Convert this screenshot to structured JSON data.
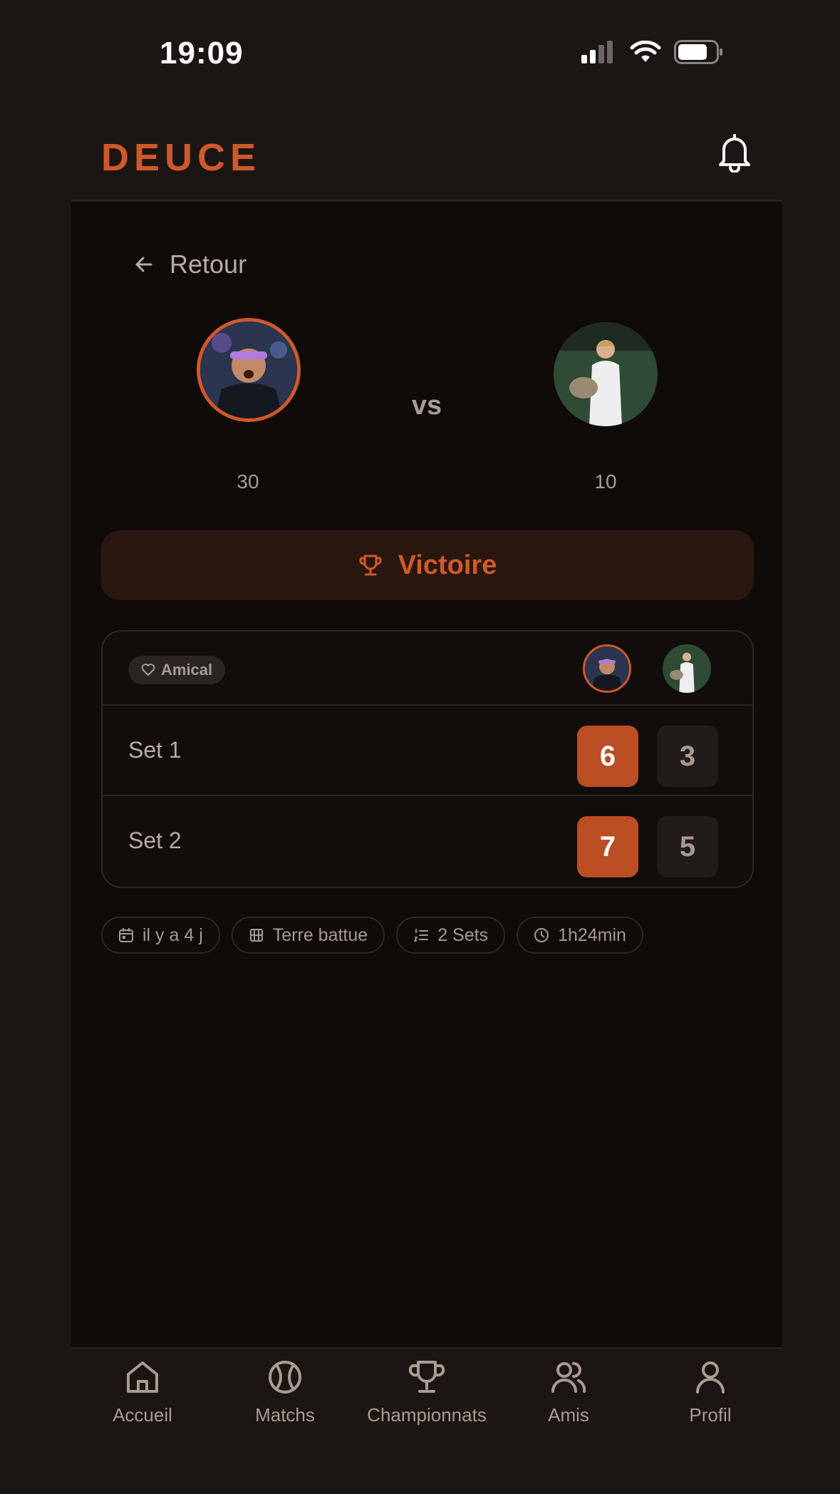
{
  "status": {
    "time": "19:09"
  },
  "header": {
    "logo": "DEUCE"
  },
  "back": {
    "label": "Retour"
  },
  "match": {
    "vs": "vs",
    "player1_score": "30",
    "player2_score": "10",
    "result": "Victoire",
    "type": "Amical",
    "sets": [
      {
        "label": "Set 1",
        "p1": "6",
        "p2": "3"
      },
      {
        "label": "Set 2",
        "p1": "7",
        "p2": "5"
      }
    ]
  },
  "chips": {
    "date": "il y a 4 j",
    "surface": "Terre battue",
    "format": "2 Sets",
    "duration": "1h24min"
  },
  "nav": {
    "home": "Accueil",
    "matches": "Matchs",
    "championships": "Championnats",
    "friends": "Amis",
    "profile": "Profil"
  },
  "colors": {
    "accent": "#cd5a2b",
    "background": "#0f0b09",
    "surface": "#1b1513"
  }
}
